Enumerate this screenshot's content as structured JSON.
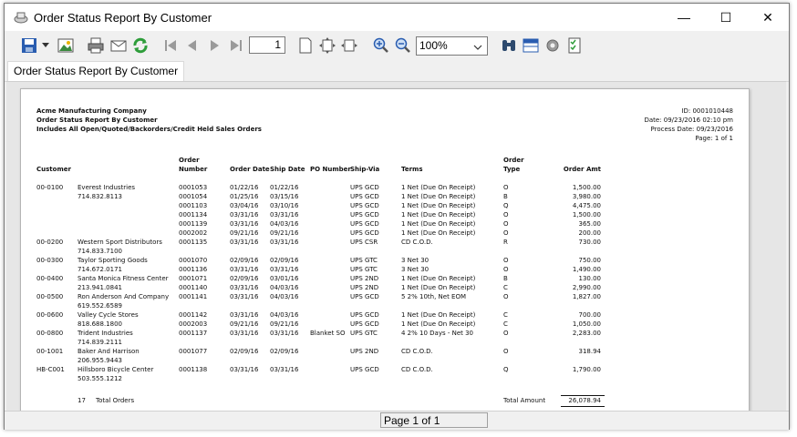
{
  "window": {
    "title": "Order Status Report By Customer",
    "controls": {
      "minimize": "—",
      "maximize": "☐",
      "close": "✕"
    }
  },
  "toolbar": {
    "page_number": "1",
    "zoom": "100%",
    "buttons": [
      "save-icon",
      "dropdown-arrow-icon",
      "export-image-icon",
      "print-icon",
      "email-icon",
      "refresh-icon",
      "first-page-icon",
      "previous-page-icon",
      "next-page-icon",
      "last-page-icon",
      "single-page-icon",
      "fit-page-icon",
      "fit-width-icon",
      "zoom-in-icon",
      "zoom-out-icon",
      "find-icon",
      "group-tree-icon",
      "settings-icon",
      "parameters-icon"
    ]
  },
  "tabs": [
    {
      "label": "Order Status Report By Customer"
    }
  ],
  "report": {
    "header": {
      "company": "Acme Manufacturing Company",
      "report_title": "Order Status Report By Customer",
      "subtitle": "Includes All Open/Quoted/Backorders/Credit Held Sales Orders",
      "id": "ID: 0001010448",
      "date": "Date: 09/23/2016 02:10 pm",
      "process_date": "Process Date: 09/23/2016",
      "page": "Page: 1 of 1"
    },
    "columns": {
      "customer": "Customer",
      "order_number_1": "Order",
      "order_number_2": "Number",
      "order_date": "Order Date",
      "ship_date": "Ship Date",
      "po_number": "PO Number",
      "ship_via": "Ship-Via",
      "terms": "Terms",
      "order_type_1": "Order",
      "order_type_2": "Type",
      "order_amt": "Order Amt"
    },
    "rows": [
      {
        "cust_id": "00-0100",
        "cust_name": "Everest Industries",
        "order": "0001053",
        "odate": "01/22/16",
        "sdate": "01/22/16",
        "po": "",
        "via": "UPS GCD",
        "terms": "1  Net (Due On Receipt)",
        "type": "O",
        "amt": "1,500.00"
      },
      {
        "cust_id": "",
        "cust_name": "714.832.8113",
        "order": "0001054",
        "odate": "01/25/16",
        "sdate": "03/15/16",
        "po": "",
        "via": "UPS GCD",
        "terms": "1  Net (Due On Receipt)",
        "type": "B",
        "amt": "3,980.00"
      },
      {
        "cust_id": "",
        "cust_name": "",
        "order": "0001103",
        "odate": "03/04/16",
        "sdate": "03/10/16",
        "po": "",
        "via": "UPS GCD",
        "terms": "1  Net (Due On Receipt)",
        "type": "Q",
        "amt": "4,475.00"
      },
      {
        "cust_id": "",
        "cust_name": "",
        "order": "0001134",
        "odate": "03/31/16",
        "sdate": "03/31/16",
        "po": "",
        "via": "UPS GCD",
        "terms": "1  Net (Due On Receipt)",
        "type": "O",
        "amt": "1,500.00"
      },
      {
        "cust_id": "",
        "cust_name": "",
        "order": "0001139",
        "odate": "03/31/16",
        "sdate": "04/03/16",
        "po": "",
        "via": "UPS GCD",
        "terms": "1  Net (Due On Receipt)",
        "type": "O",
        "amt": "365.00"
      },
      {
        "cust_id": "",
        "cust_name": "",
        "order": "0002002",
        "odate": "09/21/16",
        "sdate": "09/21/16",
        "po": "",
        "via": "UPS GCD",
        "terms": "1  Net (Due On Receipt)",
        "type": "O",
        "amt": "200.00"
      },
      {
        "cust_id": "00-0200",
        "cust_name": "Western Sport Distributors",
        "order": "0001135",
        "odate": "03/31/16",
        "sdate": "03/31/16",
        "po": "",
        "via": "UPS CSR",
        "terms": "CD C.O.D.",
        "type": "R",
        "amt": "730.00"
      },
      {
        "cust_id": "",
        "cust_name": "714.833.7100",
        "order": "",
        "odate": "",
        "sdate": "",
        "po": "",
        "via": "",
        "terms": "",
        "type": "",
        "amt": ""
      },
      {
        "cust_id": "00-0300",
        "cust_name": "Taylor Sporting Goods",
        "order": "0001070",
        "odate": "02/09/16",
        "sdate": "02/09/16",
        "po": "",
        "via": "UPS GTC",
        "terms": "3  Net 30",
        "type": "O",
        "amt": "750.00"
      },
      {
        "cust_id": "",
        "cust_name": "714.672.0171",
        "order": "0001136",
        "odate": "03/31/16",
        "sdate": "03/31/16",
        "po": "",
        "via": "UPS GTC",
        "terms": "3  Net 30",
        "type": "O",
        "amt": "1,490.00"
      },
      {
        "cust_id": "00-0400",
        "cust_name": "Santa Monica Fitness Center",
        "order": "0001071",
        "odate": "02/09/16",
        "sdate": "03/01/16",
        "po": "",
        "via": "UPS 2ND",
        "terms": "1  Net (Due On Receipt)",
        "type": "B",
        "amt": "130.00"
      },
      {
        "cust_id": "",
        "cust_name": "213.941.0841",
        "order": "0001140",
        "odate": "03/31/16",
        "sdate": "04/03/16",
        "po": "",
        "via": "UPS 2ND",
        "terms": "1  Net (Due On Receipt)",
        "type": "C",
        "amt": "2,990.00"
      },
      {
        "cust_id": "00-0500",
        "cust_name": "Ron Anderson And Company",
        "order": "0001141",
        "odate": "03/31/16",
        "sdate": "04/03/16",
        "po": "",
        "via": "UPS GCD",
        "terms": "5  2% 10th, Net EOM",
        "type": "O",
        "amt": "1,827.00"
      },
      {
        "cust_id": "",
        "cust_name": "619.552.6589",
        "order": "",
        "odate": "",
        "sdate": "",
        "po": "",
        "via": "",
        "terms": "",
        "type": "",
        "amt": ""
      },
      {
        "cust_id": "00-0600",
        "cust_name": "Valley Cycle Stores",
        "order": "0001142",
        "odate": "03/31/16",
        "sdate": "04/03/16",
        "po": "",
        "via": "UPS GCD",
        "terms": "1  Net (Due On Receipt)",
        "type": "C",
        "amt": "700.00"
      },
      {
        "cust_id": "",
        "cust_name": "818.688.1800",
        "order": "0002003",
        "odate": "09/21/16",
        "sdate": "09/21/16",
        "po": "",
        "via": "UPS GCD",
        "terms": "1  Net (Due On Receipt)",
        "type": "C",
        "amt": "1,050.00"
      },
      {
        "cust_id": "00-0800",
        "cust_name": "Trident Industries",
        "order": "0001137",
        "odate": "03/31/16",
        "sdate": "03/31/16",
        "po": "Blanket SO",
        "via": "UPS GTC",
        "terms": "4  2% 10 Days - Net 30",
        "type": "O",
        "amt": "2,283.00"
      },
      {
        "cust_id": "",
        "cust_name": "714.839.2111",
        "order": "",
        "odate": "",
        "sdate": "",
        "po": "",
        "via": "",
        "terms": "",
        "type": "",
        "amt": ""
      },
      {
        "cust_id": "00-1001",
        "cust_name": "Baker And Harrison",
        "order": "0001077",
        "odate": "02/09/16",
        "sdate": "02/09/16",
        "po": "",
        "via": "UPS 2ND",
        "terms": "CD C.O.D.",
        "type": "O",
        "amt": "318.94"
      },
      {
        "cust_id": "",
        "cust_name": "206.955.9443",
        "order": "",
        "odate": "",
        "sdate": "",
        "po": "",
        "via": "",
        "terms": "",
        "type": "",
        "amt": ""
      },
      {
        "cust_id": "HB-C001",
        "cust_name": "Hillsboro Bicycle Center",
        "order": "0001138",
        "odate": "03/31/16",
        "sdate": "03/31/16",
        "po": "",
        "via": "UPS GCD",
        "terms": "CD C.O.D.",
        "type": "Q",
        "amt": "1,790.00"
      },
      {
        "cust_id": "",
        "cust_name": "503.555.1212",
        "order": "",
        "odate": "",
        "sdate": "",
        "po": "",
        "via": "",
        "terms": "",
        "type": "",
        "amt": ""
      }
    ],
    "footer": {
      "count": "17",
      "count_label": "Total Orders",
      "total_label": "Total Amount",
      "total": "26,078.94"
    }
  },
  "statusbar": {
    "page_text": "Page 1 of 1"
  },
  "colors": {
    "accent_blue": "#2a5db0",
    "icon_green": "#2e9d3a",
    "toolbar_bg": "#f0f0f0"
  }
}
